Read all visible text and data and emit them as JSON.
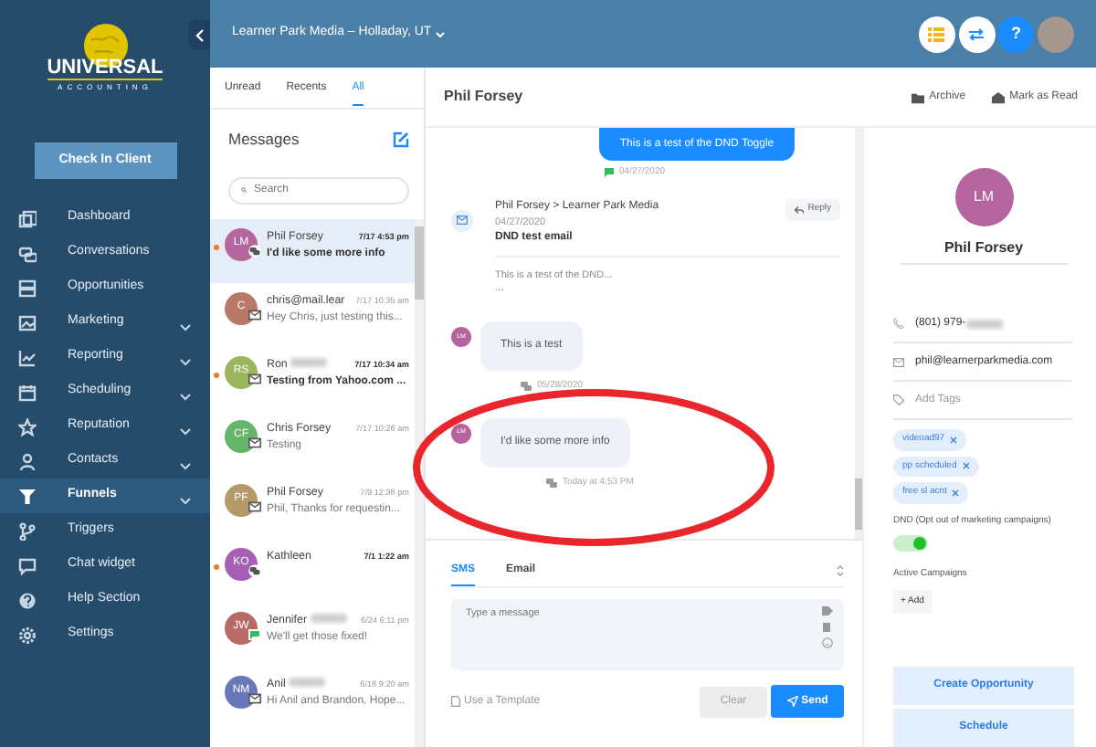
{
  "sidebar": {
    "logo": {
      "title": "UNIVERSAL",
      "subtitle": "ACCOUNTING"
    },
    "check_in_button": "Check In Client",
    "items": [
      {
        "kind": "copy",
        "label": "Dashboard",
        "expandable": false,
        "selected": false
      },
      {
        "kind": "chat",
        "label": "Conversations",
        "expandable": false,
        "selected": false
      },
      {
        "kind": "stack",
        "label": "Opportunities",
        "expandable": false,
        "selected": false
      },
      {
        "kind": "image",
        "label": "Marketing",
        "expandable": true,
        "selected": false
      },
      {
        "kind": "chart",
        "label": "Reporting",
        "expandable": true,
        "selected": false
      },
      {
        "kind": "calendar",
        "label": "Scheduling",
        "expandable": true,
        "selected": false
      },
      {
        "kind": "star",
        "label": "Reputation",
        "expandable": true,
        "selected": false
      },
      {
        "kind": "person",
        "label": "Contacts",
        "expandable": true,
        "selected": false
      },
      {
        "kind": "funnel",
        "label": "Funnels",
        "expandable": true,
        "selected": true
      },
      {
        "kind": "branch",
        "label": "Triggers",
        "expandable": false,
        "selected": false
      },
      {
        "kind": "message",
        "label": "Chat widget",
        "expandable": false,
        "selected": false
      },
      {
        "kind": "help",
        "label": "Help Section",
        "expandable": false,
        "selected": false
      },
      {
        "kind": "gear",
        "label": "Settings",
        "expandable": false,
        "selected": false
      }
    ]
  },
  "top_bar": {
    "location": "Learner Park Media – Holladay, UT",
    "help_glyph": "?"
  },
  "conversations": {
    "tabs": [
      {
        "label": "Unread",
        "selected": false
      },
      {
        "label": "Recents",
        "selected": false
      },
      {
        "label": "All",
        "selected": true
      }
    ],
    "title": "Messages",
    "search": {
      "placeholder": "Search"
    },
    "items": [
      {
        "initials": "LM",
        "color": "#b5649e",
        "name": "Phil Forsey",
        "redacted": false,
        "time": "7/17 4:53 pm",
        "preview": "I'd like some more info",
        "unread": true,
        "kind": "chat",
        "selected": true
      },
      {
        "initials": "C",
        "color": "#b87a66",
        "name": "chris@mail.lear",
        "redacted": false,
        "time": "7/17 10:35 am",
        "preview": "Hey Chris, just testing this...",
        "unread": false,
        "kind": "email",
        "selected": false
      },
      {
        "initials": "RS",
        "color": "#9cb65e",
        "name": "Ron",
        "redacted": true,
        "time": "7/17 10:34 am",
        "preview": "Testing from Yahoo.com ...",
        "unread": true,
        "kind": "email",
        "selected": false
      },
      {
        "initials": "CF",
        "color": "#66b56a",
        "name": "Chris Forsey",
        "redacted": false,
        "time": "7/17 10:26 am",
        "preview": "Testing",
        "unread": false,
        "kind": "email",
        "selected": false
      },
      {
        "initials": "PF",
        "color": "#b49a6a",
        "name": "Phil Forsey",
        "redacted": false,
        "time": "7/9 12:38 pm",
        "preview": "Phil, Thanks for requestin...",
        "unread": false,
        "kind": "email",
        "selected": false
      },
      {
        "initials": "KO",
        "color": "#a55fb5",
        "name": "Kathleen",
        "redacted": false,
        "time": "7/1 1:22 am",
        "unread": true,
        "kind": "chat",
        "selected": false
      },
      {
        "initials": "JW",
        "color": "#b86a66",
        "name": "Jennifer",
        "redacted": true,
        "time": "6/24 6:11 pm",
        "preview": "We'll get those fixed!",
        "unread": false,
        "kind": "sms",
        "selected": false
      },
      {
        "initials": "NM",
        "color": "#6878b8",
        "name": "Anil",
        "redacted": true,
        "time": "6/18 9:20 am",
        "preview": "Hi Anil and Brandon, Hope...",
        "unread": false,
        "kind": "email",
        "selected": false
      }
    ]
  },
  "thread": {
    "contact_name": "Phil Forsey",
    "actions": [
      "Archive",
      "Mark as Read"
    ],
    "messages": [
      {
        "kind": "outgoing",
        "text": "This is a test of the DND Toggle",
        "date": "04/27/2020"
      },
      {
        "kind": "email",
        "from": "Phil Forsey > Learner Park Media",
        "date": "04/27/2020",
        "subject": "DND test email",
        "body": "This is a test of the DND...",
        "more": "...",
        "reply": "Reply"
      },
      {
        "kind": "incoming",
        "initials": "LM",
        "color": "#b5649e",
        "text": "This is a test",
        "date": "05/28/2020"
      },
      {
        "kind": "incoming",
        "initials": "LM",
        "color": "#b5649e",
        "text": "I'd like some more info",
        "date": "Today at 4:53 PM"
      }
    ],
    "annotation": {
      "kind": "ellipse",
      "color": "#e8262b"
    }
  },
  "composer": {
    "tabs": [
      {
        "label": "SMS",
        "selected": true
      },
      {
        "label": "Email",
        "selected": false
      }
    ],
    "placeholder": "Type a message",
    "template": "Use a Template",
    "clear": {
      "label": "Clear",
      "disabled": true
    },
    "send": "Send"
  },
  "contact": {
    "initials": "LM",
    "color": "#b5649e",
    "name": "Phil Forsey",
    "phone": "(801) 979-",
    "phone_redacted": true,
    "email": "phil@learnerparkmedia.com",
    "tags_placeholder": "Add Tags",
    "tags": [
      "videoad97",
      "pp scheduled",
      "free sl acnt"
    ],
    "dnd_label": "DND (Opt out of marketing campaigns)",
    "dnd_on": true,
    "campaigns_label": "Active Campaigns",
    "add_campaign": "+ Add",
    "buttons": [
      "Create Opportunity",
      "Schedule"
    ]
  }
}
